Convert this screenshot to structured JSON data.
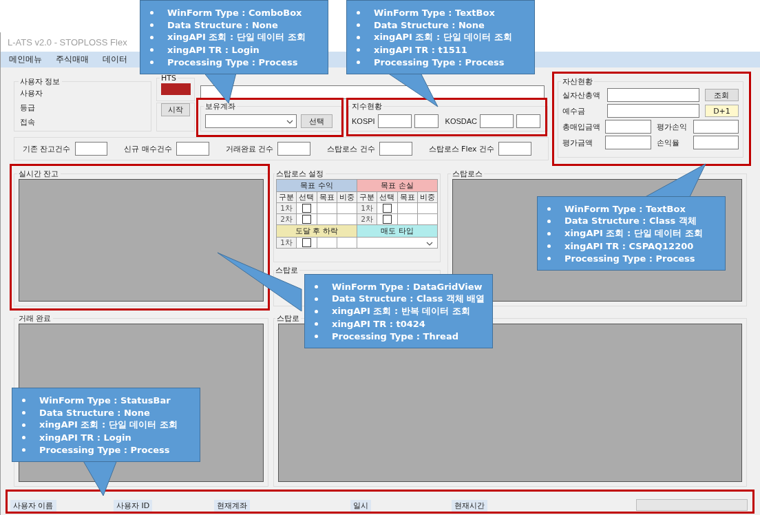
{
  "window": {
    "title": "L-ATS v2.0 - STOPLOSS Flex"
  },
  "menu": [
    "메인메뉴",
    "주식매매",
    "데이터"
  ],
  "user_info": {
    "title": "사용자 정보",
    "labels": [
      "사용자",
      "등급",
      "접속"
    ]
  },
  "hts": {
    "label": "HTS",
    "connected": false
  },
  "start_button": "시작",
  "account": {
    "title": "보유계좌",
    "button": "선택",
    "highlighted": true
  },
  "index": {
    "title": "지수현황",
    "labels": [
      "KOSPI",
      "KOSDAC"
    ],
    "highlighted": true
  },
  "assets": {
    "title": "자산현황",
    "highlighted": true,
    "total_label": "실자산총액",
    "query_button": "조회",
    "deposit_label": "예수금",
    "d1_button": "D+1",
    "pairs": [
      [
        "총매입금액",
        "평가손익"
      ],
      [
        "평가금액",
        "손익율"
      ]
    ]
  },
  "counts": [
    "기존 잔고건수",
    "신규 매수건수",
    "거래완료 건수",
    "스탑로스 건수",
    "스탑로스 Flex 건수"
  ],
  "realtime": {
    "title": "실시간 잔고",
    "highlighted": true
  },
  "stoploss_settings": {
    "title": "스탑로스 설정",
    "profit": "목표 수익",
    "loss": "목표 손실",
    "profit_columns": [
      "구분",
      "선택",
      "목표",
      "비중"
    ],
    "loss_columns": [
      "구분",
      "선택",
      "목표",
      "비중"
    ],
    "profit_rows": [
      {
        "label": "1차",
        "checked": false
      },
      {
        "label": "2차",
        "checked": false
      }
    ],
    "loss_rows": [
      {
        "label": "1차",
        "checked": false
      },
      {
        "label": "2차",
        "checked": false
      }
    ],
    "drop": "도달 후 하락",
    "sell_type": "매도 타입",
    "drop_rows": [
      {
        "label": "1차",
        "checked": false
      }
    ]
  },
  "stoploss": {
    "title": "스탑로스"
  },
  "flex_settings": {
    "title": "스탑로"
  },
  "done": {
    "title": "거래 완료"
  },
  "flex": {
    "title": "스탑로"
  },
  "status_bar": {
    "labels": [
      "사용자 이름",
      "사용자 ID",
      "현재계좌",
      "일시",
      "현재시간"
    ],
    "progress": {
      "level": 0
    },
    "highlighted": true
  },
  "callouts": [
    {
      "lines": [
        "WinForm Type : ComboBox",
        "Data Structure : None",
        "xingAPI 조회 : 단일 데이터 조회",
        "xingAPI TR : Login",
        "Processing Type : Process"
      ]
    },
    {
      "lines": [
        "WinForm Type : TextBox",
        "Data Structure : None",
        "xingAPI 조회 : 단일 데이터 조회",
        "xingAPI TR : t1511",
        "Processing Type : Process"
      ]
    },
    {
      "lines": [
        "WinForm Type : TextBox",
        "Data Structure : Class 객체",
        "xingAPI 조회 : 단일 데이터 조회",
        "xingAPI TR : CSPAQ12200",
        "Processing Type : Process"
      ]
    },
    {
      "lines": [
        "WinForm Type : DataGridView",
        "Data Structure : Class 객체 배열",
        "xingAPI 조회 : 반복 데이터 조회",
        "xingAPI TR : t0424",
        "Processing Type : Thread"
      ]
    },
    {
      "lines": [
        "WinForm Type : StatusBar",
        "Data Structure : None",
        "xingAPI 조회 : 단일 데이터 조회",
        "xingAPI TR : Login",
        "Processing Type : Process"
      ]
    }
  ]
}
